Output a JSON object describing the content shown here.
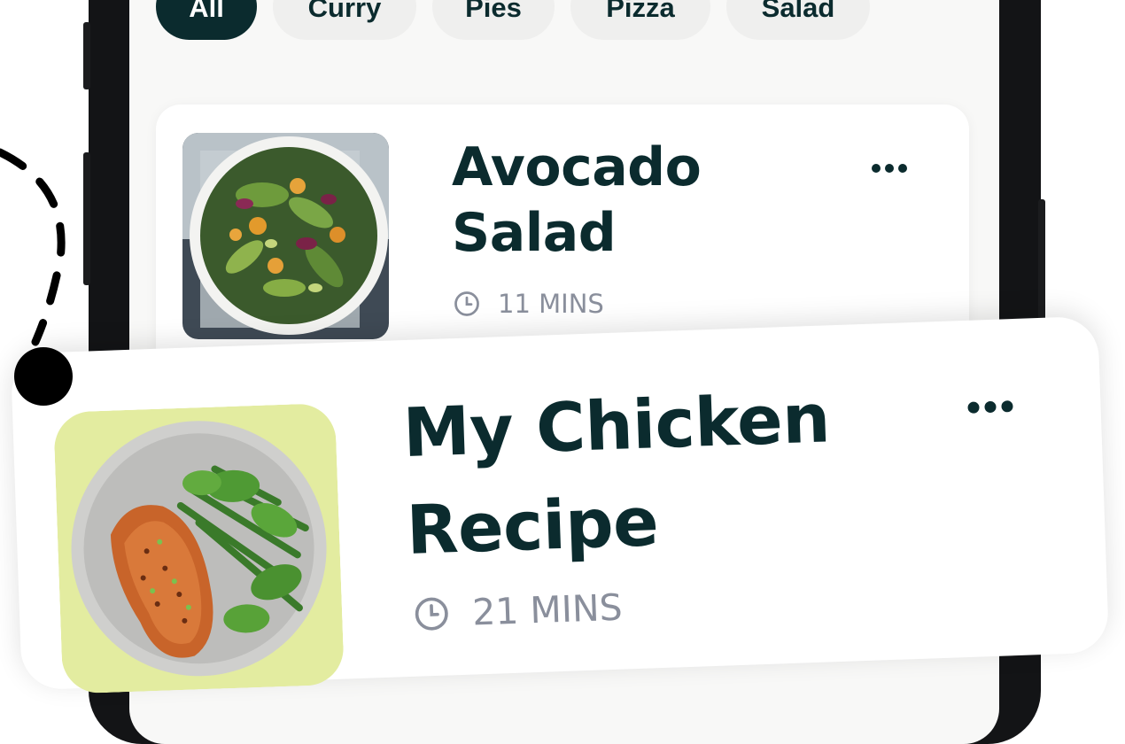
{
  "categories": [
    {
      "label": "All",
      "active": true
    },
    {
      "label": "Curry",
      "active": false
    },
    {
      "label": "Pies",
      "active": false
    },
    {
      "label": "Pizza",
      "active": false
    },
    {
      "label": "Salad",
      "active": false
    }
  ],
  "recipes": [
    {
      "title_line1": "Avocado",
      "title_line2": "Salad",
      "time": "11 MINS",
      "image": "avocado-salad-bowl"
    },
    {
      "title_line1": "My Chicken",
      "title_line2": "Recipe",
      "time": "21 MINS",
      "image": "salmon-green-beans-plate"
    }
  ],
  "icons": {
    "time": "clock-icon",
    "menu": "more-horizontal-icon"
  },
  "colors": {
    "primary": "#0b2b2e",
    "chip_bg": "#efefee",
    "muted_text": "#8a8f9c",
    "thumb_accent": "#e3eca0"
  }
}
